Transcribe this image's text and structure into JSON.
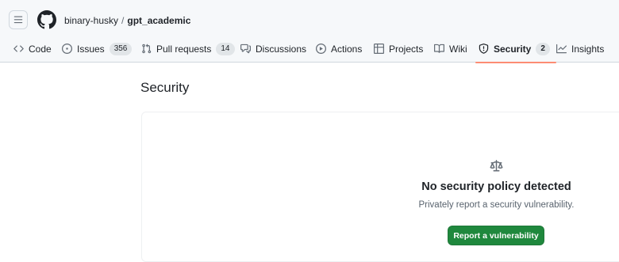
{
  "breadcrumb": {
    "owner": "binary-husky",
    "separator": "/",
    "repo": "gpt_academic"
  },
  "tabs": [
    {
      "label": "Code",
      "icon": "code-icon"
    },
    {
      "label": "Issues",
      "icon": "issue-opened-icon",
      "count": "356"
    },
    {
      "label": "Pull requests",
      "icon": "git-pull-request-icon",
      "count": "14"
    },
    {
      "label": "Discussions",
      "icon": "comment-discussion-icon"
    },
    {
      "label": "Actions",
      "icon": "play-icon"
    },
    {
      "label": "Projects",
      "icon": "table-icon"
    },
    {
      "label": "Wiki",
      "icon": "book-icon"
    },
    {
      "label": "Security",
      "icon": "shield-icon",
      "count": "2",
      "selected": true
    },
    {
      "label": "Insights",
      "icon": "graph-icon"
    }
  ],
  "page": {
    "title": "Security"
  },
  "blankslate": {
    "icon": "law-icon",
    "title": "No security policy detected",
    "description": "Privately report a security vulnerability.",
    "button_label": "Report a vulnerability"
  },
  "colors": {
    "header_bg": "#f6f8fa",
    "selected_underline": "#fd8c73",
    "primary_button": "#1f883d"
  }
}
